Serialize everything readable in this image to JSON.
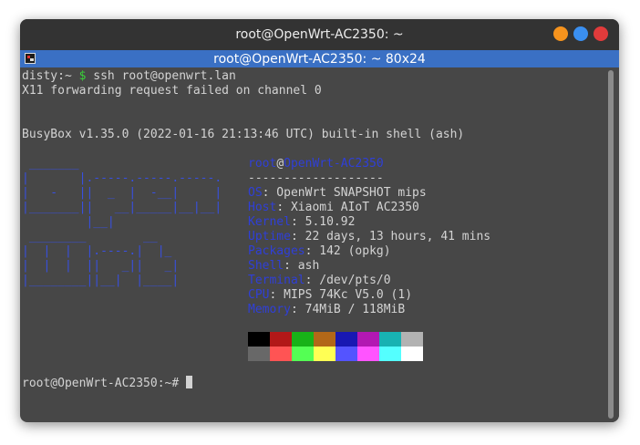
{
  "window": {
    "title": "root@OpenWrt-AC2350: ~"
  },
  "tab": {
    "title": "root@OpenWrt-AC2350: ~ 80x24"
  },
  "terminal": {
    "line1": {
      "user": "disty:~",
      "sign": " $",
      "command": " ssh root@openwrt.lan"
    },
    "line2": "X11 forwarding request failed on channel 0",
    "line3": "BusyBox v1.35.0 (2022-01-16 21:13:46 UTC) built-in shell (ash)",
    "logo": [
      " _______",
      "|       |.-----.-----.-----.",
      "|   -   ||  _  |  -__|     |",
      "|_______||   __|_____|__|__|",
      "         |__|",
      " ________        __",
      "|  |  |  |.----.|  |_",
      "|  |  |  ||   _||   _|",
      "|________||__|  |____|"
    ],
    "info": {
      "user": "root",
      "at": "@",
      "host": "OpenWrt-AC2350",
      "separator": "-------------------",
      "rows": [
        {
          "label": "OS",
          "value": ": OpenWrt SNAPSHOT mips"
        },
        {
          "label": "Host",
          "value": ": Xiaomi AIoT AC2350"
        },
        {
          "label": "Kernel",
          "value": ": 5.10.92"
        },
        {
          "label": "Uptime",
          "value": ": 22 days, 13 hours, 41 mins"
        },
        {
          "label": "Packages",
          "value": ": 142 (opkg)"
        },
        {
          "label": "Shell",
          "value": ": ash"
        },
        {
          "label": "Terminal",
          "value": ": /dev/pts/0"
        },
        {
          "label": "CPU",
          "value": ": MIPS 74Kc V5.0 (1)"
        },
        {
          "label": "Memory",
          "value": ": 74MiB / 118MiB"
        }
      ]
    },
    "palette": {
      "top": [
        "#000000",
        "#b21818",
        "#18b218",
        "#b26818",
        "#1818b2",
        "#b218b2",
        "#18b2b2",
        "#b2b2b2"
      ],
      "bottom": [
        "#686868",
        "#ff5454",
        "#54ff54",
        "#ffff54",
        "#5454ff",
        "#ff54ff",
        "#54ffff",
        "#ffffff"
      ]
    },
    "final_prompt": "root@OpenWrt-AC2350:~# "
  },
  "colors": {
    "terminal_bg": "#474747",
    "titlebar": "#333333",
    "tabbar": "#3a70c4",
    "text": "#d3d3d3",
    "accent_blue": "#2f3fd8",
    "prompt_green": "#3ad13a"
  }
}
